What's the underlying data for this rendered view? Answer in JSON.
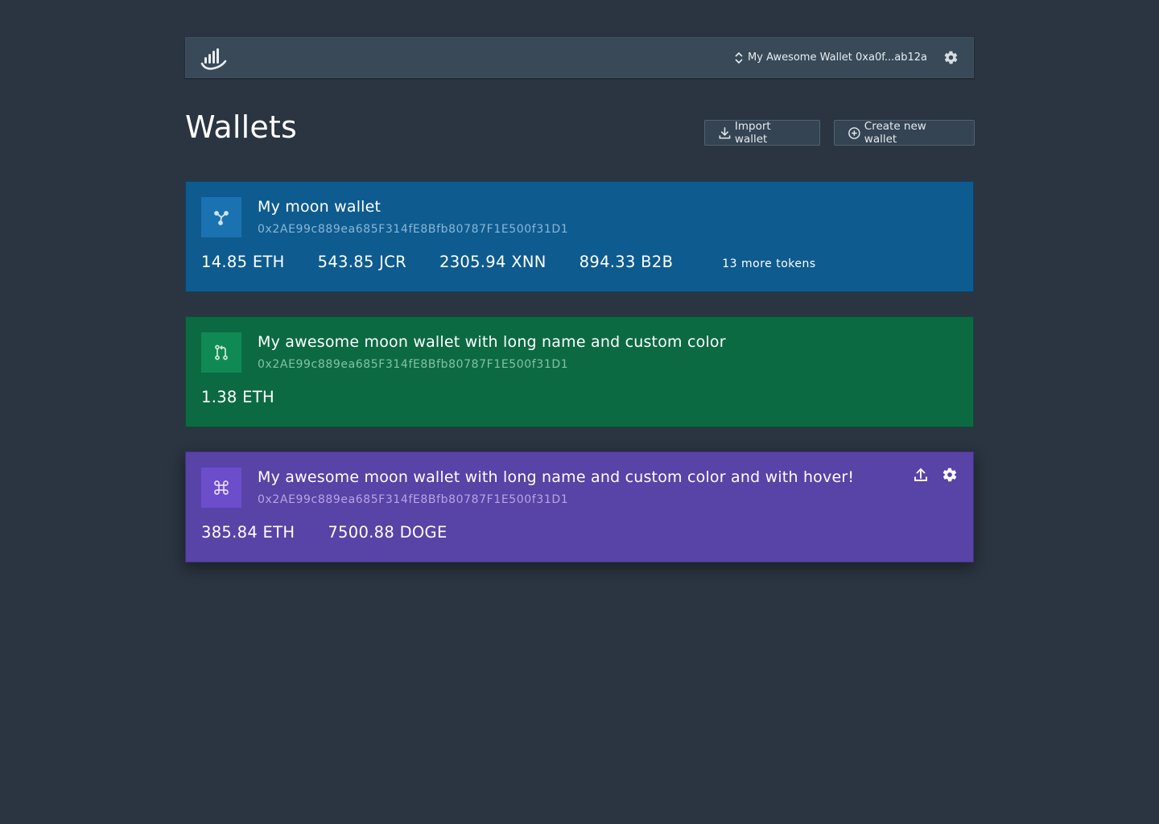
{
  "header": {
    "logo_icon": "bar-chart-logo-icon",
    "current_wallet": "My Awesome Wallet 0xa0f...ab12a",
    "switch_icon": "sort-icon",
    "settings_icon": "gear-icon"
  },
  "page": {
    "title": "Wallets",
    "import_label": "Import wallet",
    "create_label": "Create new wallet"
  },
  "wallets": [
    {
      "name": "My moon wallet",
      "address": "0x2AE99c889ea685F314fE8Bfb80787F1E500f31D1",
      "icon": "share-nodes-icon",
      "color": "#0e5b8f",
      "balances": [
        "14.85 ETH",
        "543.85 JCR",
        "2305.94 XNN",
        "894.33 B2B"
      ],
      "more_tokens": "13 more tokens"
    },
    {
      "name": "My awesome moon wallet with long name and custom color",
      "address": "0x2AE99c889ea685F314fE8Bfb80787F1E500f31D1",
      "icon": "git-pull-request-icon",
      "color": "#0c6a43",
      "balances": [
        "1.38 ETH"
      ]
    },
    {
      "name": "My awesome moon wallet with long name and custom color and with hover!",
      "address": "0x2AE99c889ea685F314fE8Bfb80787F1E500f31D1",
      "icon": "command-icon",
      "color": "#5843a7",
      "balances": [
        "385.84 ETH",
        "7500.88 DOGE"
      ],
      "actions": [
        "upload-icon",
        "gear-icon"
      ]
    }
  ]
}
